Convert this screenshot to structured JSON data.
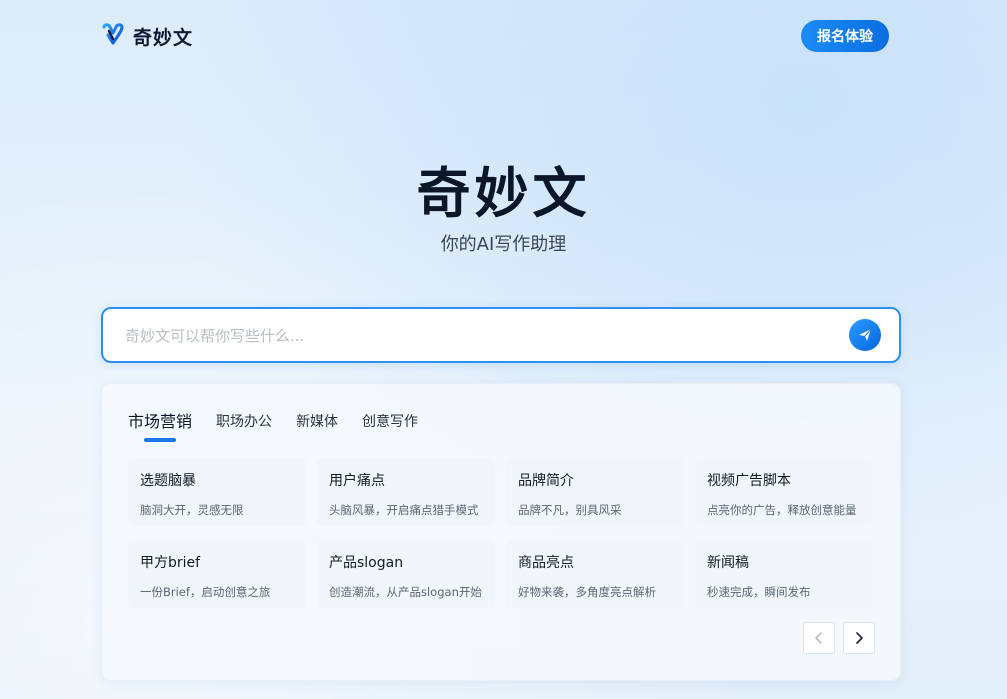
{
  "header": {
    "brand_name": "奇妙文",
    "signup_label": "报名体验"
  },
  "hero": {
    "title": "奇妙文",
    "subtitle": "你的AI写作助理"
  },
  "search": {
    "placeholder": "奇妙文可以帮你写些什么..."
  },
  "tabs": [
    {
      "label": "市场营销",
      "active": true
    },
    {
      "label": "职场办公",
      "active": false
    },
    {
      "label": "新媒体",
      "active": false
    },
    {
      "label": "创意写作",
      "active": false
    }
  ],
  "cards": [
    {
      "title": "选题脑暴",
      "desc": "脑洞大开，灵感无限"
    },
    {
      "title": "用户痛点",
      "desc": "头脑风暴，开启痛点猎手模式"
    },
    {
      "title": "品牌简介",
      "desc": "品牌不凡，别具风采"
    },
    {
      "title": "视频广告脚本",
      "desc": "点亮你的广告，释放创意能量"
    },
    {
      "title": "甲方brief",
      "desc": "一份Brief，启动创意之旅"
    },
    {
      "title": "产品slogan",
      "desc": "创造潮流，从产品slogan开始"
    },
    {
      "title": "商品亮点",
      "desc": "好物来袭，多角度亮点解析"
    },
    {
      "title": "新闻稿",
      "desc": "秒速完成，瞬间发布"
    }
  ],
  "icons": {
    "logo": "brand-logo-icon",
    "send": "send-icon",
    "prev": "chevron-left-icon",
    "next": "chevron-right-icon"
  },
  "colors": {
    "accent": "#1678ef",
    "title": "#0b1629"
  }
}
